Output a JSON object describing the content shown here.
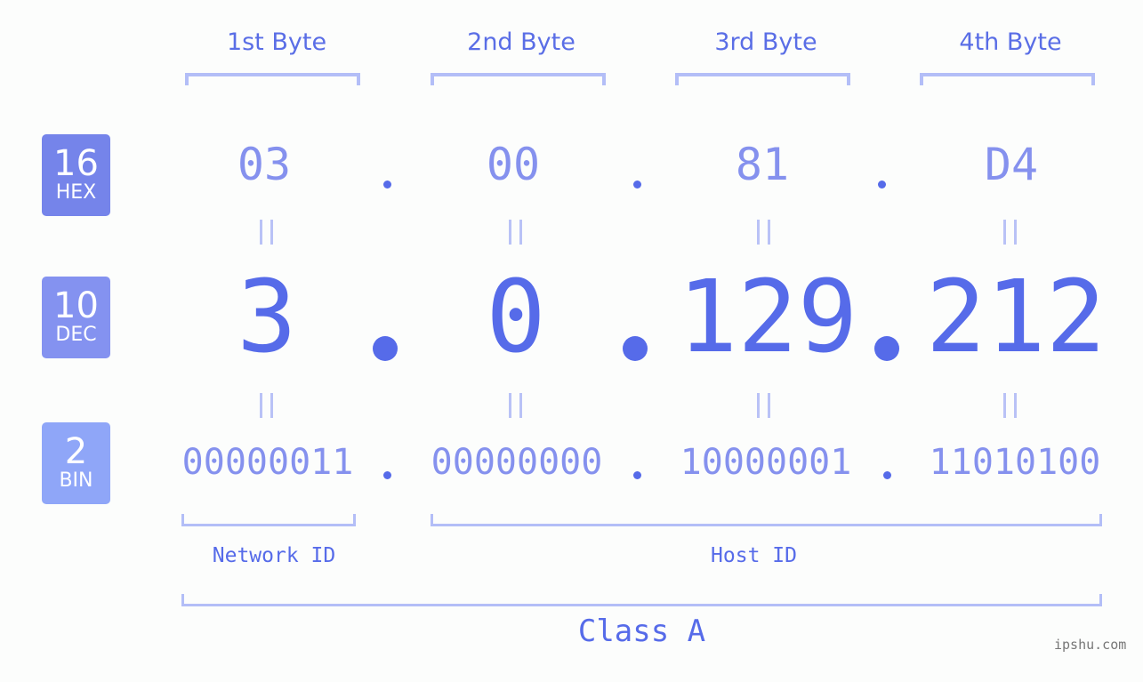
{
  "bytes": [
    {
      "label": "1st Byte",
      "hex": "03",
      "dec": "3",
      "bin": "00000011"
    },
    {
      "label": "2nd Byte",
      "hex": "00",
      "dec": "0",
      "bin": "00000000"
    },
    {
      "label": "3rd Byte",
      "hex": "81",
      "dec": "129",
      "bin": "10000001"
    },
    {
      "label": "4th Byte",
      "hex": "D4",
      "dec": "212",
      "bin": "11010100"
    }
  ],
  "badges": {
    "hex": {
      "num": "16",
      "label": "HEX",
      "color": "#7584ea"
    },
    "dec": {
      "num": "10",
      "label": "DEC",
      "color": "#8492f0"
    },
    "bin": {
      "num": "2",
      "label": "BIN",
      "color": "#8fa6f8"
    }
  },
  "separator": ".",
  "equals": "=",
  "network_id": "Network ID",
  "host_id": "Host ID",
  "ip_class": "Class A",
  "watermark": "ipshu.com",
  "colors": {
    "accent": "#566be9",
    "light": "#8591ee",
    "bracket": "#b3bef7",
    "background": "#fcfdfc"
  }
}
